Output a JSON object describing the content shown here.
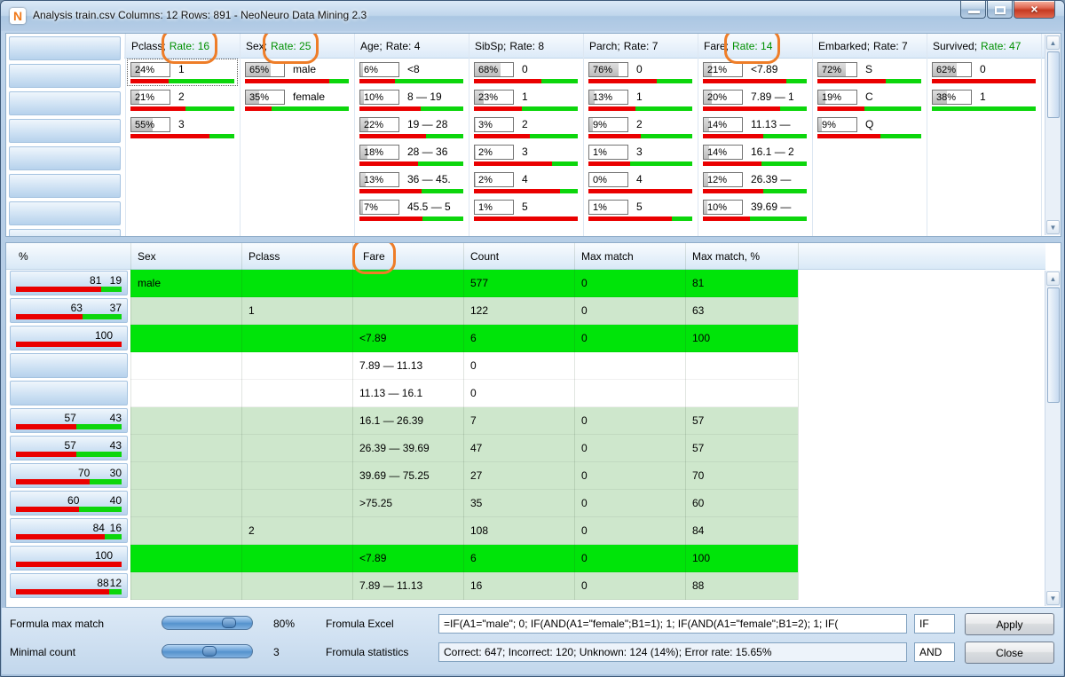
{
  "window": {
    "title": "Analysis  train.csv Columns: 12 Rows: 891 - NeoNeuro Data Mining 2.3",
    "icon_letter": "N"
  },
  "colors": {
    "bar_red": "#ea0000",
    "bar_green": "#0cd60c",
    "row_bright_green": "#00e409",
    "row_pale_green": "#cee7cc",
    "rate_highlight_green": "#009000",
    "annotation_orange": "#ee7d28"
  },
  "top_table": {
    "columns": [
      {
        "name": "Pclass;",
        "rate": "Rate: 16",
        "rate_highlight": true,
        "circled": true,
        "items": [
          {
            "pct": "24%",
            "fill": 24,
            "label": "1",
            "red": 37,
            "focused": true
          },
          {
            "pct": "21%",
            "fill": 21,
            "label": "2",
            "red": 53
          },
          {
            "pct": "55%",
            "fill": 55,
            "label": "3",
            "red": 76
          }
        ]
      },
      {
        "name": "Sex;",
        "rate": "Rate: 25",
        "rate_highlight": true,
        "circled": true,
        "items": [
          {
            "pct": "65%",
            "fill": 65,
            "label": "male",
            "red": 81
          },
          {
            "pct": "35%",
            "fill": 35,
            "label": "female",
            "red": 26
          }
        ]
      },
      {
        "name": "Age;",
        "rate": "Rate: 4",
        "rate_highlight": false,
        "circled": false,
        "items": [
          {
            "pct": "6%",
            "fill": 6,
            "label": "<8",
            "red": 34
          },
          {
            "pct": "10%",
            "fill": 10,
            "label": "8 — 19",
            "red": 59
          },
          {
            "pct": "22%",
            "fill": 22,
            "label": "19 — 28",
            "red": 64
          },
          {
            "pct": "18%",
            "fill": 18,
            "label": "28 — 36",
            "red": 56
          },
          {
            "pct": "13%",
            "fill": 13,
            "label": "36 — 45.",
            "red": 60
          },
          {
            "pct": "7%",
            "fill": 7,
            "label": "45.5 — 5",
            "red": 61
          }
        ]
      },
      {
        "name": "SibSp;",
        "rate": "Rate: 8",
        "rate_highlight": false,
        "circled": false,
        "items": [
          {
            "pct": "68%",
            "fill": 68,
            "label": "0",
            "red": 65
          },
          {
            "pct": "23%",
            "fill": 23,
            "label": "1",
            "red": 46
          },
          {
            "pct": "3%",
            "fill": 3,
            "label": "2",
            "red": 54
          },
          {
            "pct": "2%",
            "fill": 2,
            "label": "3",
            "red": 75
          },
          {
            "pct": "2%",
            "fill": 2,
            "label": "4",
            "red": 83
          },
          {
            "pct": "1%",
            "fill": 1,
            "label": "5",
            "red": 100
          }
        ]
      },
      {
        "name": "Parch;",
        "rate": "Rate: 7",
        "rate_highlight": false,
        "circled": false,
        "items": [
          {
            "pct": "76%",
            "fill": 76,
            "label": "0",
            "red": 66
          },
          {
            "pct": "13%",
            "fill": 13,
            "label": "1",
            "red": 45
          },
          {
            "pct": "9%",
            "fill": 9,
            "label": "2",
            "red": 50
          },
          {
            "pct": "1%",
            "fill": 1,
            "label": "3",
            "red": 40
          },
          {
            "pct": "0%",
            "fill": 0,
            "label": "4",
            "red": 100
          },
          {
            "pct": "1%",
            "fill": 1,
            "label": "5",
            "red": 80
          }
        ]
      },
      {
        "name": "Fare;",
        "rate": "Rate: 14",
        "rate_highlight": true,
        "circled": true,
        "items": [
          {
            "pct": "21%",
            "fill": 21,
            "label": "<7.89",
            "red": 80
          },
          {
            "pct": "20%",
            "fill": 20,
            "label": "7.89 — 1",
            "red": 74
          },
          {
            "pct": "14%",
            "fill": 14,
            "label": "11.13 —",
            "red": 58
          },
          {
            "pct": "14%",
            "fill": 14,
            "label": "16.1 — 2",
            "red": 56
          },
          {
            "pct": "12%",
            "fill": 12,
            "label": "26.39 —",
            "red": 58
          },
          {
            "pct": "10%",
            "fill": 10,
            "label": "39.69 —",
            "red": 45
          }
        ]
      },
      {
        "name": "Embarked;",
        "rate": "Rate: 7",
        "rate_highlight": false,
        "circled": false,
        "items": [
          {
            "pct": "72%",
            "fill": 72,
            "label": "S",
            "red": 66
          },
          {
            "pct": "19%",
            "fill": 19,
            "label": "C",
            "red": 45
          },
          {
            "pct": "9%",
            "fill": 9,
            "label": "Q",
            "red": 61
          }
        ]
      },
      {
        "name": "Survived;",
        "rate": "Rate: 47",
        "rate_highlight": true,
        "circled": false,
        "items": [
          {
            "pct": "62%",
            "fill": 62,
            "label": "0",
            "red": 100
          },
          {
            "pct": "38%",
            "fill": 38,
            "label": "1",
            "red": 0
          }
        ]
      }
    ]
  },
  "bottom_table": {
    "headers": [
      "%",
      "Sex",
      "Pclass",
      "Fare",
      "Count",
      "Max match",
      "Max match, %"
    ],
    "fare_header_circled": true,
    "rows": [
      {
        "style": "bright",
        "died": 81,
        "survived": 19,
        "sex": "male",
        "pclass": "",
        "fare": "",
        "count": "577",
        "max_match": "0",
        "max_match_pct": "81"
      },
      {
        "style": "pale",
        "died": 63,
        "survived": 37,
        "sex": "",
        "pclass": "1",
        "fare": "",
        "count": "122",
        "max_match": "0",
        "max_match_pct": "63"
      },
      {
        "style": "bright",
        "died": 100,
        "survived": 0,
        "sex": "",
        "pclass": "",
        "fare": "<7.89",
        "count": "6",
        "max_match": "0",
        "max_match_pct": "100"
      },
      {
        "style": "white",
        "died": null,
        "survived": null,
        "sex": "",
        "pclass": "",
        "fare": "7.89 — 11.13",
        "count": "0",
        "max_match": "",
        "max_match_pct": ""
      },
      {
        "style": "white",
        "died": null,
        "survived": null,
        "sex": "",
        "pclass": "",
        "fare": "11.13 — 16.1",
        "count": "0",
        "max_match": "",
        "max_match_pct": ""
      },
      {
        "style": "pale",
        "died": 57,
        "survived": 43,
        "sex": "",
        "pclass": "",
        "fare": "16.1 — 26.39",
        "count": "7",
        "max_match": "0",
        "max_match_pct": "57"
      },
      {
        "style": "pale",
        "died": 57,
        "survived": 43,
        "sex": "",
        "pclass": "",
        "fare": "26.39 — 39.69",
        "count": "47",
        "max_match": "0",
        "max_match_pct": "57"
      },
      {
        "style": "pale",
        "died": 70,
        "survived": 30,
        "sex": "",
        "pclass": "",
        "fare": "39.69 — 75.25",
        "count": "27",
        "max_match": "0",
        "max_match_pct": "70"
      },
      {
        "style": "pale",
        "died": 60,
        "survived": 40,
        "sex": "",
        "pclass": "",
        "fare": ">75.25",
        "count": "35",
        "max_match": "0",
        "max_match_pct": "60"
      },
      {
        "style": "pale",
        "died": 84,
        "survived": 16,
        "sex": "",
        "pclass": "2",
        "fare": "",
        "count": "108",
        "max_match": "0",
        "max_match_pct": "84"
      },
      {
        "style": "bright",
        "died": 100,
        "survived": 0,
        "sex": "",
        "pclass": "",
        "fare": "<7.89",
        "count": "6",
        "max_match": "0",
        "max_match_pct": "100"
      },
      {
        "style": "pale",
        "died": 88,
        "survived": 12,
        "sex": "",
        "pclass": "",
        "fare": "7.89 — 11.13",
        "count": "16",
        "max_match": "0",
        "max_match_pct": "88"
      }
    ]
  },
  "controls": {
    "formula_max_match_label": "Formula max match",
    "formula_max_match_value": "80%",
    "formula_max_match_slider_pct": 78,
    "minimal_count_label": "Minimal count",
    "minimal_count_value": "3",
    "minimal_count_slider_pct": 52,
    "formula_excel_label": "Fromula Excel",
    "formula_excel_value": "=IF(A1=\"male\"; 0; IF(AND(A1=\"female\";B1=1); 1; IF(AND(A1=\"female\";B1=2); 1; IF(",
    "formula_statistics_label": "Fromula statistics",
    "formula_statistics_value": "Correct: 647; Incorrect: 120; Unknown: 124 (14%); Error rate: 15.65%",
    "if_operator": "IF",
    "and_operator": "AND",
    "apply_label": "Apply",
    "close_label": "Close"
  }
}
